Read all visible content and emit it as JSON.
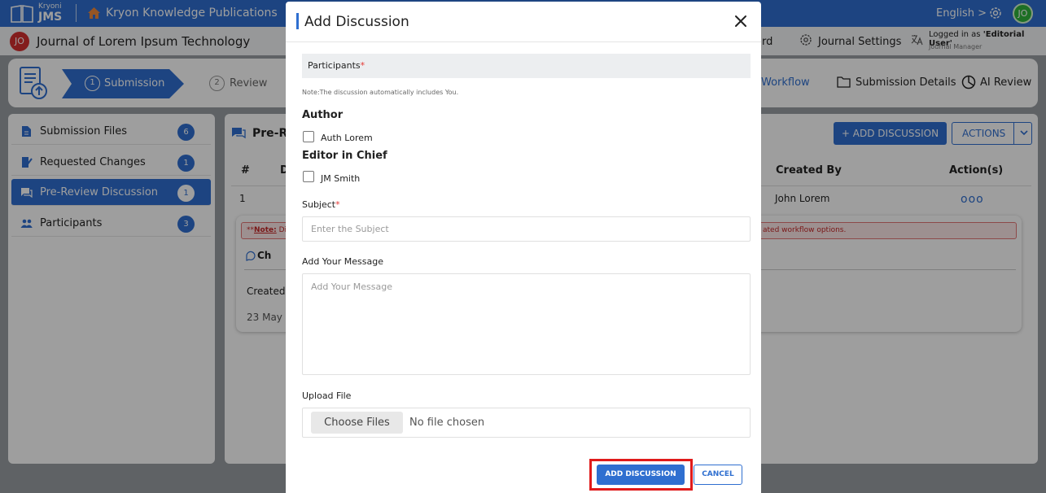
{
  "topbar": {
    "logo_small": "Kryoni",
    "logo_big": "JMS",
    "publisher": "Kryon Knowledge Publications",
    "language": "English >",
    "avatar": "JO"
  },
  "journalbar": {
    "avatar": "JO",
    "journal_name": "Journal of Lorem Ipsum Technology",
    "dashboard_partial": "rd",
    "journal_settings": "Journal Settings",
    "logged_in_prefix": "Logged in as ",
    "logged_in_user": "'Editorial User'",
    "role": "Journal Manager"
  },
  "steps": {
    "step1_num": "1",
    "step1_label": "Submission",
    "step2_num": "2",
    "step2_label": "Review",
    "workflow": "Workflow",
    "submission_details": "Submission Details",
    "ai_review": "AI Review"
  },
  "sidebar": {
    "items": [
      {
        "label": "Submission Files",
        "count": "6"
      },
      {
        "label": "Requested Changes",
        "count": "1"
      },
      {
        "label": "Pre-Review Discussion",
        "count": "1"
      },
      {
        "label": "Participants",
        "count": "3"
      }
    ]
  },
  "content": {
    "title_partial": "Pre-Re",
    "add_discussion": "+ ADD DISCUSSION",
    "actions": "ACTIONS",
    "col_num": "#",
    "col_d": "D",
    "col_created_by": "Created By",
    "col_actions": "Action(s)",
    "row_num": "1",
    "row_created_by": "John Lorem",
    "row_actions": "ooo",
    "note_prefix": "**",
    "note_label": "Note:",
    "note_partial": " Di",
    "note_tail": "ated workflow options.",
    "ch_partial": "Ch",
    "created_partial": "Created",
    "date_partial": "23 May 2"
  },
  "modal": {
    "title": "Add Discussion",
    "participants_label": "Participants",
    "required_mark": "*",
    "note": "Note:The discussion automatically includes You.",
    "group_author": "Author",
    "author_name": "Auth Lorem",
    "group_editor": "Editor in Chief",
    "editor_name": "JM Smith",
    "subject_label": "Subject",
    "subject_placeholder": "Enter the Subject",
    "message_label": "Add Your Message",
    "message_placeholder": "Add Your Message",
    "upload_label": "Upload File",
    "choose_files": "Choose Files",
    "no_file": "No file chosen",
    "add_button": "ADD DISCUSSION",
    "cancel_button": "CANCEL"
  },
  "colors": {
    "primary": "#2f6fd0",
    "highlight": "#e01b1b",
    "avatar_green": "#2fb43d",
    "avatar_red": "#d32f2f"
  }
}
